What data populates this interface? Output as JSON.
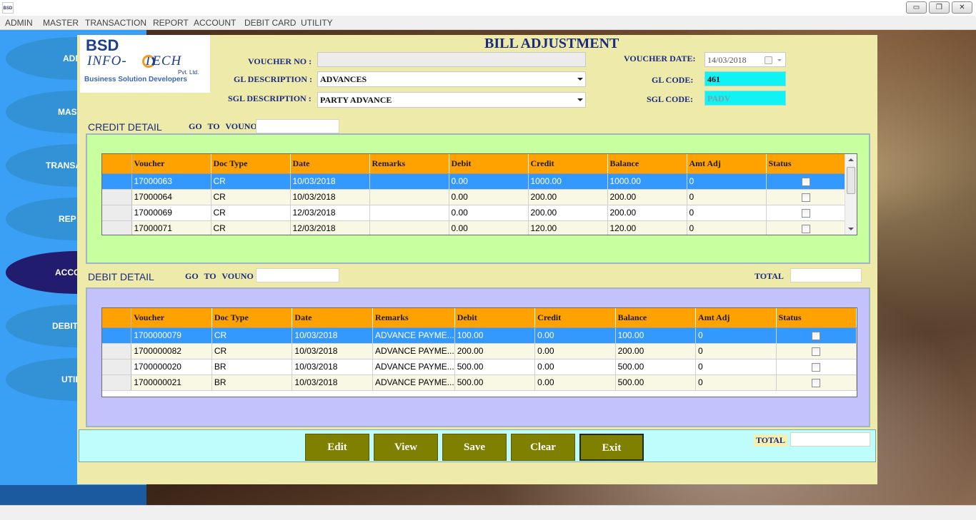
{
  "window": {
    "app_icon_text": "BSD",
    "minimize": "▭",
    "restore": "❐",
    "close": "✕"
  },
  "menu": [
    "ADMIN",
    "MASTER",
    "TRANSACTION",
    "REPORT",
    "ACCOUNT",
    "DEBIT CARD",
    "UTILITY"
  ],
  "sidebar": [
    "ADM",
    "MAS",
    "TRANSA",
    "REP",
    "ACCO",
    "DEBIT",
    "UTIL"
  ],
  "logo": {
    "line1": "BSD",
    "line2a": "INFO-",
    "line2b": "TECH",
    "pvt": "Pvt. Ltd.",
    "tagline": "Business Solution Developers"
  },
  "form": {
    "title": "BILL ADJUSTMENT",
    "voucher_no_label": "VOUCHER NO :",
    "voucher_no_value": "",
    "gl_desc_label": "GL DESCRIPTION :",
    "gl_desc_value": "ADVANCES",
    "sgl_desc_label": "SGL DESCRIPTION :",
    "sgl_desc_value": "PARTY ADVANCE",
    "voucher_date_label": "VOUCHER DATE:",
    "voucher_date_value": "14/03/2018",
    "gl_code_label": "GL CODE:",
    "gl_code_value": "461",
    "sgl_code_label": "SGL CODE:",
    "sgl_code_value": "PADV"
  },
  "credit": {
    "title": "CREDIT DETAIL",
    "goto_label": "GO TO VOUNO",
    "columns": [
      "Voucher",
      "Doc Type",
      "Date",
      "Remarks",
      "Debit",
      "Credit",
      "Balance",
      "Amt Adj",
      "Status"
    ],
    "rows": [
      {
        "voucher": "17000063",
        "doctype": "CR",
        "date": "10/03/2018",
        "remarks": "",
        "debit": "0.00",
        "credit": "1000.00",
        "balance": "1000.00",
        "amtadj": "0"
      },
      {
        "voucher": "17000064",
        "doctype": "CR",
        "date": "10/03/2018",
        "remarks": "",
        "debit": "0.00",
        "credit": "200.00",
        "balance": "200.00",
        "amtadj": "0"
      },
      {
        "voucher": "17000069",
        "doctype": "CR",
        "date": "12/03/2018",
        "remarks": "",
        "debit": "0.00",
        "credit": "200.00",
        "balance": "200.00",
        "amtadj": "0"
      },
      {
        "voucher": "17000071",
        "doctype": "CR",
        "date": "12/03/2018",
        "remarks": "",
        "debit": "0.00",
        "credit": "120.00",
        "balance": "120.00",
        "amtadj": "0"
      }
    ]
  },
  "debit": {
    "title": "DEBIT DETAIL",
    "goto_label": "GO TO VOUNO",
    "total_label": "TOTAL",
    "columns": [
      "Voucher",
      "Doc Type",
      "Date",
      "Remarks",
      "Debit",
      "Credit",
      "Balance",
      "Amt Adj",
      "Status"
    ],
    "rows": [
      {
        "voucher": "1700000079",
        "doctype": "CR",
        "date": "10/03/2018",
        "remarks": "ADVANCE PAYME...",
        "debit": "100.00",
        "credit": "0.00",
        "balance": "100.00",
        "amtadj": "0"
      },
      {
        "voucher": "1700000082",
        "doctype": "CR",
        "date": "10/03/2018",
        "remarks": "ADVANCE PAYME...",
        "debit": "200.00",
        "credit": "0.00",
        "balance": "200.00",
        "amtadj": "0"
      },
      {
        "voucher": "1700000020",
        "doctype": "BR",
        "date": "10/03/2018",
        "remarks": "ADVANCE PAYME...",
        "debit": "500.00",
        "credit": "0.00",
        "balance": "500.00",
        "amtadj": "0"
      },
      {
        "voucher": "1700000021",
        "doctype": "BR",
        "date": "10/03/2018",
        "remarks": "ADVANCE PAYME...",
        "debit": "500.00",
        "credit": "0.00",
        "balance": "500.00",
        "amtadj": "0"
      }
    ]
  },
  "buttons": {
    "edit": "Edit",
    "view": "View",
    "save": "Save",
    "clear": "Clear",
    "exit": "Exit",
    "total_label": "TOTAL"
  },
  "colors": {
    "panel": "#eeeaaa",
    "grid_header": "#ffa200",
    "selection": "#3399ff",
    "button": "#7f7f00"
  }
}
